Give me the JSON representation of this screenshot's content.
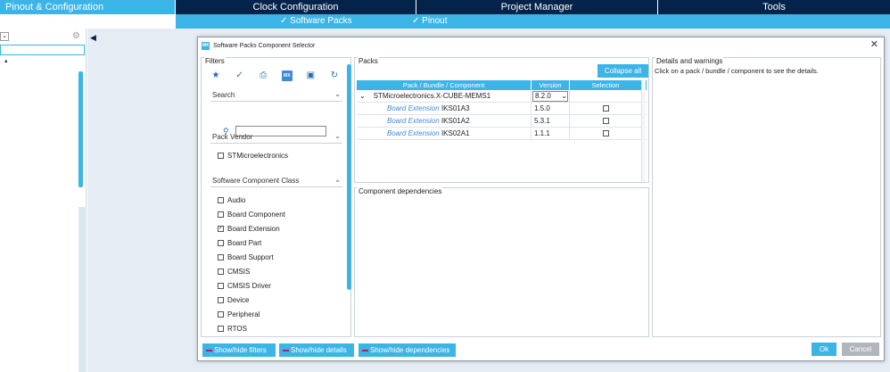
{
  "top_tabs": [
    {
      "label": "Pinout & Configuration",
      "active": true
    },
    {
      "label": "Clock Configuration",
      "active": false
    },
    {
      "label": "Project Manager",
      "active": false
    },
    {
      "label": "Tools",
      "active": false
    }
  ],
  "sub_menu": {
    "software_packs": "✓ Software Packs",
    "pinout": "✓ Pinout"
  },
  "dialog": {
    "title": "Software Packs Component Selector",
    "logo": "MX",
    "close": "✕",
    "filters": {
      "title": "Filters",
      "icons": [
        "star-icon",
        "check-circle-icon",
        "package-icon",
        "mx-icon",
        "chip-icon",
        "refresh-icon"
      ],
      "search_label": "Search",
      "search_placeholder": "",
      "pack_vendor_label": "Pack Vendor",
      "vendors": [
        {
          "label": "STMicroelectronics",
          "checked": false
        }
      ],
      "component_class_label": "Software Component Class",
      "classes": [
        {
          "label": "Audio",
          "checked": false
        },
        {
          "label": "Board Component",
          "checked": false
        },
        {
          "label": "Board Extension",
          "checked": true
        },
        {
          "label": "Board Part",
          "checked": false
        },
        {
          "label": "Board Support",
          "checked": false
        },
        {
          "label": "CMSIS",
          "checked": false
        },
        {
          "label": "CMSIS Driver",
          "checked": false
        },
        {
          "label": "Device",
          "checked": false
        },
        {
          "label": "Peripheral",
          "checked": false
        },
        {
          "label": "RTOS",
          "checked": false
        }
      ]
    },
    "packs": {
      "title": "Packs",
      "collapse_all": "Collapse all",
      "columns": [
        "Pack / Bundle / Component",
        "Version",
        "Selection"
      ],
      "pack_row": {
        "name": "STMicroelectronics.X-CUBE-MEMS1",
        "version": "8.2.0"
      },
      "rows": [
        {
          "prefix": "Board Extension",
          "name": "IKS01A3",
          "version": "1.5.0",
          "selected": false
        },
        {
          "prefix": "Board Extension",
          "name": "IKS01A2",
          "version": "5.3.1",
          "selected": false
        },
        {
          "prefix": "Board Extension",
          "name": "IKS02A1",
          "version": "1.1.1",
          "selected": false
        }
      ]
    },
    "dependencies": {
      "title": "Component dependencies"
    },
    "details": {
      "title": "Details and warnings",
      "hint": "Click on a pack / bundle / component to see the details."
    },
    "buttons": {
      "show_filters": "Show/hide filters",
      "show_details": "Show/hide details",
      "show_dependencies": "Show/hide dependencies",
      "ok": "Ok",
      "cancel": "Cancel"
    }
  }
}
